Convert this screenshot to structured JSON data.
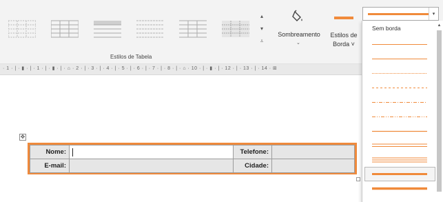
{
  "ribbon": {
    "table_styles_group_label": "Estilos de Tabela",
    "shading_label": "Sombreamento",
    "border_styles_label_line1": "Estilos de",
    "border_styles_label_line2": "Borda ˅",
    "accent_color": "#f08a3a"
  },
  "ruler": {
    "text": "· 1 · | · ▮ · | · 1 · | · ▮ · | · ⌂ · 2 · | · 3 · | · 4 · | · 5 · | · 6 · | · 7 · | · 8 · | · ⌂ · 10 · | · ▮ · | · 12 · | · 13 · | · 14 · ⊞"
  },
  "table": {
    "row1": {
      "label1": "Nome:",
      "value1": "",
      "label2": "Telefone:",
      "value2": ""
    },
    "row2": {
      "label1": "E-mail:",
      "value1": "",
      "label2": "Cidade:",
      "value2": ""
    },
    "border_color": "#ef8a3c"
  },
  "border_dropdown": {
    "first_item": "Sem borda",
    "selected_index": 10,
    "items": [
      {
        "style": "none"
      },
      {
        "style": "solid-thin"
      },
      {
        "style": "solid-thin"
      },
      {
        "style": "dotted"
      },
      {
        "style": "dashed"
      },
      {
        "style": "dash-dot"
      },
      {
        "style": "dash-dot-dot"
      },
      {
        "style": "solid"
      },
      {
        "style": "double"
      },
      {
        "style": "triple"
      },
      {
        "style": "solid-thick"
      },
      {
        "style": "solid-thick"
      }
    ]
  }
}
